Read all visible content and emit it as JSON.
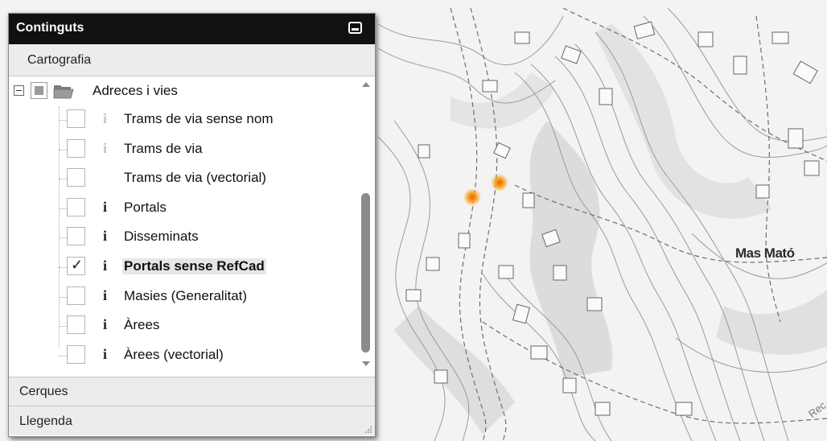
{
  "map": {
    "place_label": "Mas Mató",
    "road_label": "Rec",
    "markers": [
      "portal-marker",
      "portal-marker"
    ]
  },
  "panel": {
    "title": "Continguts",
    "minimize_icon": "minimize-icon",
    "sections": {
      "cartografia": "Cartografia",
      "cerques": "Cerques",
      "llegenda": "Llegenda"
    },
    "folder": {
      "label": "Adreces i vies",
      "icon": "folder-open-icon",
      "state": "partial"
    },
    "layers": [
      {
        "label": "Trams de via sense nom",
        "info": "i",
        "info_enabled": false,
        "checked": false,
        "selected": false
      },
      {
        "label": "Trams de via",
        "info": "i",
        "info_enabled": false,
        "checked": false,
        "selected": false
      },
      {
        "label": "Trams de via (vectorial)",
        "info": "",
        "info_enabled": false,
        "checked": false,
        "selected": false
      },
      {
        "label": "Portals",
        "info": "i",
        "info_enabled": true,
        "checked": false,
        "selected": false
      },
      {
        "label": "Disseminats",
        "info": "i",
        "info_enabled": true,
        "checked": false,
        "selected": false
      },
      {
        "label": "Portals sense RefCad",
        "info": "i",
        "info_enabled": true,
        "checked": true,
        "check_mark": "✓",
        "selected": true
      },
      {
        "label": "Masies (Generalitat)",
        "info": "i",
        "info_enabled": true,
        "checked": false,
        "selected": false
      },
      {
        "label": "Àrees",
        "info": "i",
        "info_enabled": true,
        "checked": false,
        "selected": false
      },
      {
        "label": "Àrees (vectorial)",
        "info": "i",
        "info_enabled": true,
        "checked": false,
        "selected": false
      }
    ],
    "scrollbar": {
      "position_fraction": 0.62,
      "visible_fraction": 0.55
    }
  },
  "colors": {
    "header_bg": "#111111",
    "section_bg": "#ececec",
    "marker_orange": "#f7a21b",
    "marker_red": "#ee5a22"
  }
}
